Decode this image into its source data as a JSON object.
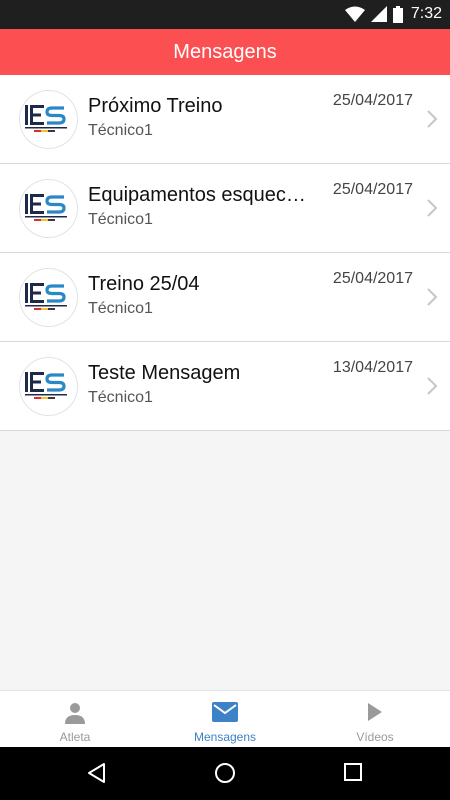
{
  "status_bar": {
    "time": "7:32",
    "icons": [
      "wifi-icon",
      "signal-icon",
      "battery-icon"
    ]
  },
  "header": {
    "title": "Mensagens",
    "color": "#fb4f51"
  },
  "messages": [
    {
      "title": "Próximo Treino",
      "author": "Técnico1",
      "date": "25/04/2017",
      "avatar": "ies-logo"
    },
    {
      "title": "Equipamentos esquecidos",
      "author": "Técnico1",
      "date": "25/04/2017",
      "avatar": "ies-logo"
    },
    {
      "title": "Treino 25/04",
      "author": "Técnico1",
      "date": "25/04/2017",
      "avatar": "ies-logo"
    },
    {
      "title": "Teste Mensagem",
      "author": "Técnico1",
      "date": "13/04/2017",
      "avatar": "ies-logo"
    }
  ],
  "tabs": [
    {
      "label": "Atleta",
      "icon": "person-icon",
      "active": false
    },
    {
      "label": "Mensagens",
      "icon": "mail-icon",
      "active": true
    },
    {
      "label": "Vídeos",
      "icon": "play-icon",
      "active": false
    }
  ],
  "colors": {
    "accent": "#3d82c7",
    "inactive": "#9a9a9a"
  },
  "nav_bar": {
    "buttons": [
      "back-icon",
      "home-icon",
      "recents-icon"
    ]
  }
}
